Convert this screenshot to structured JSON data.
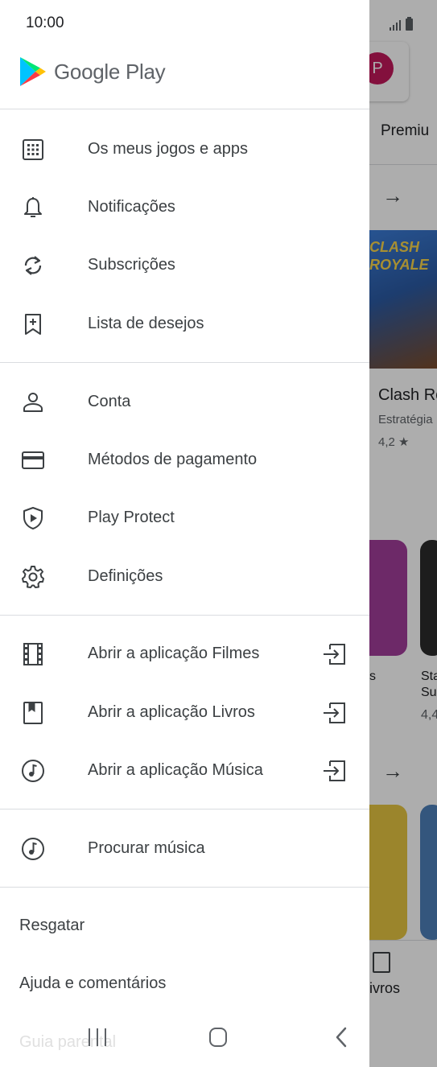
{
  "status_bar": {
    "time": "10:00"
  },
  "drawer": {
    "brand": "Google Play",
    "primary_items": [
      {
        "label": "Os meus jogos e apps",
        "icon": "apps-grid-icon"
      },
      {
        "label": "Notificações",
        "icon": "bell-icon"
      },
      {
        "label": "Subscrições",
        "icon": "refresh-icon"
      },
      {
        "label": "Lista de desejos",
        "icon": "bookmark-add-icon"
      }
    ],
    "account_items": [
      {
        "label": "Conta",
        "icon": "person-icon"
      },
      {
        "label": "Métodos de pagamento",
        "icon": "credit-card-icon"
      },
      {
        "label": "Play Protect",
        "icon": "shield-play-icon"
      },
      {
        "label": "Definições",
        "icon": "gear-icon"
      }
    ],
    "app_items": [
      {
        "label": "Abrir a aplicação Filmes",
        "icon": "film-icon",
        "ext_icon": "open-app-icon"
      },
      {
        "label": "Abrir a aplicação Livros",
        "icon": "book-icon",
        "ext_icon": "open-app-icon"
      },
      {
        "label": "Abrir a aplicação Música",
        "icon": "music-note-icon",
        "ext_icon": "open-app-icon"
      }
    ],
    "music_item": {
      "label": "Procurar música",
      "icon": "music-note-icon"
    },
    "plain_items": [
      "Resgatar",
      "Ajuda e comentários",
      "Guia parental"
    ]
  },
  "background": {
    "avatar_letter": "P",
    "tab_label": "Premiu",
    "banner_text": "CLASH ROYALE",
    "app_title": "Clash Ro",
    "app_category": "Estratégia",
    "app_rating": "4,2 ★",
    "small_label_s": "s",
    "small_label_sta": "Sta",
    "small_label_su": "Su",
    "small_label_44": "4,4",
    "nav_livros": "ivros"
  },
  "colors": {
    "scrim": "#00000052",
    "drawer_bg": "#ffffff",
    "text": "#3c4043",
    "divider": "#dadce0"
  }
}
